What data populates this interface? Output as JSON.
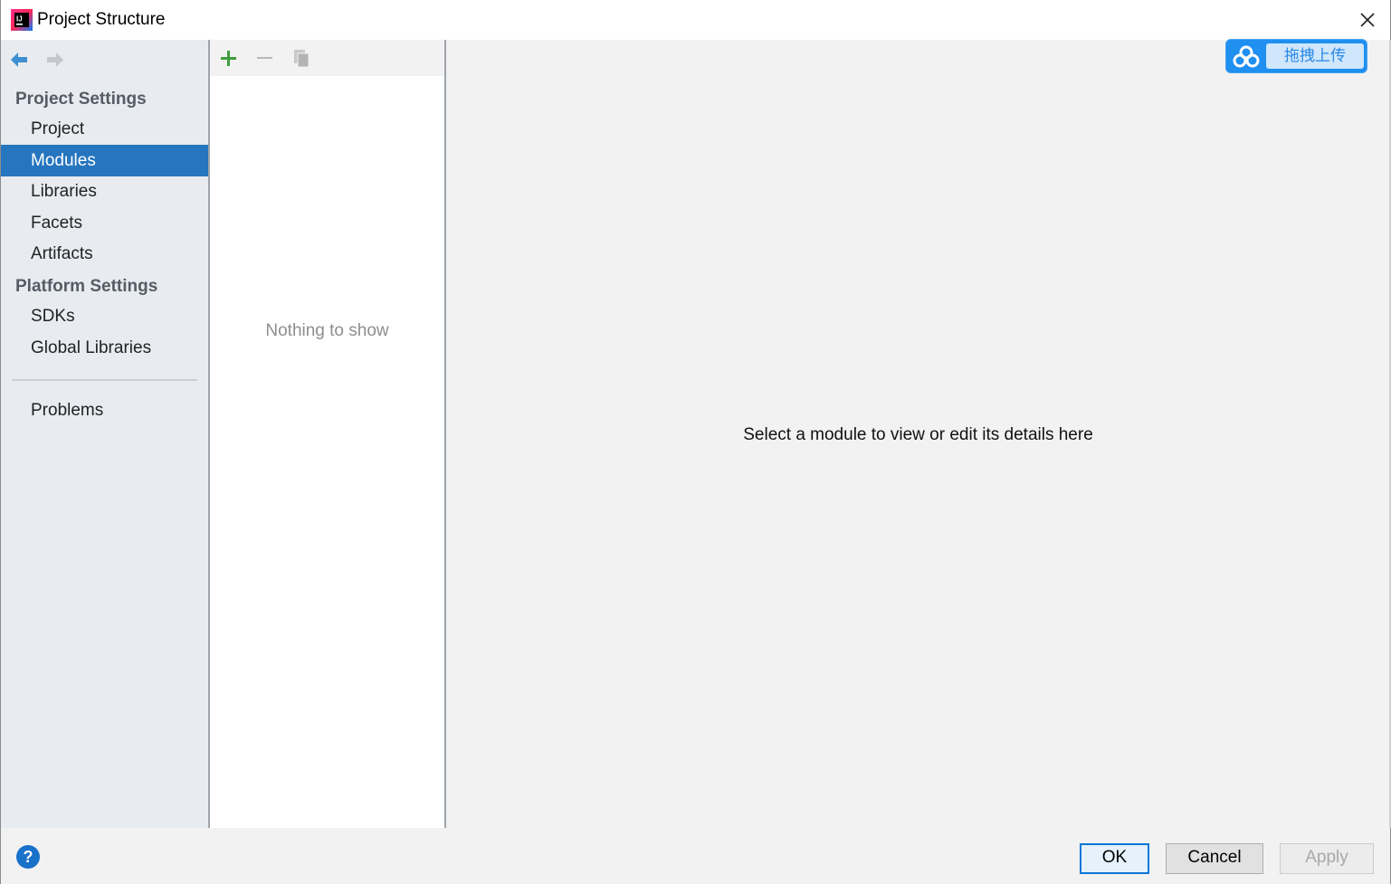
{
  "window": {
    "title": "Project Structure",
    "app_icon": "intellij-idea-icon",
    "close_icon": "close-icon"
  },
  "sidebar": {
    "nav": {
      "back_icon": "back-arrow-icon",
      "forward_icon": "forward-arrow-icon"
    },
    "project_settings_title": "Project Settings",
    "project_settings_items": [
      {
        "label": "Project",
        "selected": false
      },
      {
        "label": "Modules",
        "selected": true
      },
      {
        "label": "Libraries",
        "selected": false
      },
      {
        "label": "Facets",
        "selected": false
      },
      {
        "label": "Artifacts",
        "selected": false
      }
    ],
    "platform_settings_title": "Platform Settings",
    "platform_settings_items": [
      {
        "label": "SDKs",
        "selected": false
      },
      {
        "label": "Global Libraries",
        "selected": false
      }
    ],
    "problems_label": "Problems",
    "selected_color": "#2675bf"
  },
  "list_panel": {
    "toolbar": {
      "add_icon": "plus-icon",
      "remove_icon": "minus-icon",
      "copy_icon": "copy-icon"
    },
    "empty_text": "Nothing to show"
  },
  "detail": {
    "message": "Select a module to view or edit its details here"
  },
  "upload_widget": {
    "icon": "baidu-cloud-icon",
    "label": "拖拽上传"
  },
  "footer": {
    "help_label": "?",
    "ok_label": "OK",
    "cancel_label": "Cancel",
    "apply_label": "Apply",
    "apply_enabled": false
  },
  "colors": {
    "accent": "#2675bf",
    "add_green": "#3e9e3e",
    "upload_blue": "#1f8ff0"
  }
}
